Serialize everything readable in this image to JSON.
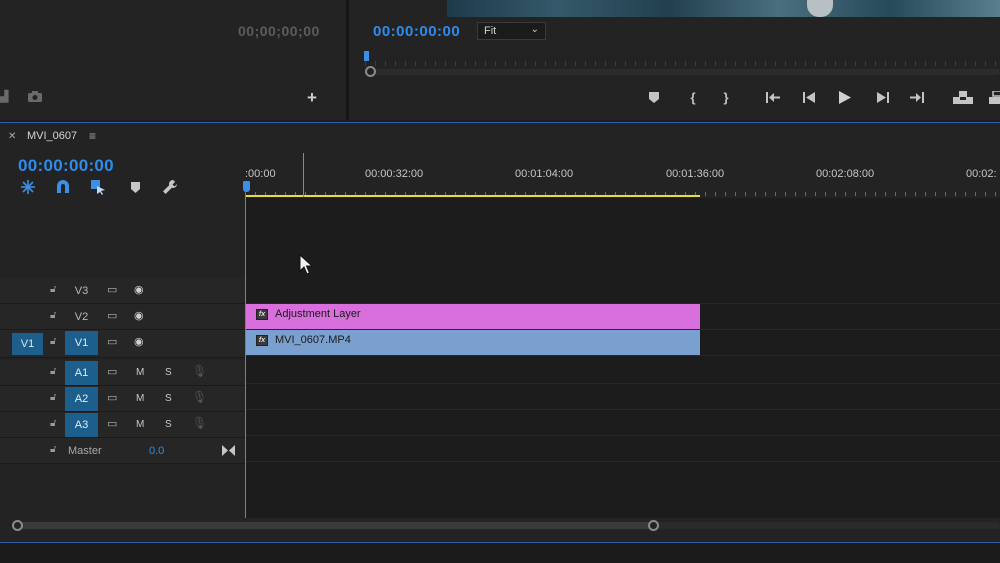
{
  "source_monitor": {
    "timecode": "00;00;00;00"
  },
  "program_monitor": {
    "timecode": "00:00:00:00",
    "zoom": "Fit",
    "transport_icons": [
      "add-marker-icon",
      "mark-in-icon",
      "mark-out-icon",
      "go-to-in-icon",
      "step-back-icon",
      "play-icon",
      "step-forward-icon",
      "go-to-out-icon",
      "lift-icon",
      "extract-icon"
    ]
  },
  "timeline": {
    "tab_name": "MVI_0607",
    "timecode": "00:00:00:00",
    "ruler_labels": [
      ":00:00",
      "00:00:32:00",
      "00:01:04:00",
      "00:01:36:00",
      "00:02:08:00",
      "00:02:"
    ],
    "tracks": {
      "v3": {
        "name": "V3"
      },
      "v2": {
        "name": "V2"
      },
      "v1": {
        "name": "V1",
        "source": "V1"
      },
      "a1": {
        "name": "A1",
        "m": "M",
        "s": "S"
      },
      "a2": {
        "name": "A2",
        "m": "M",
        "s": "S"
      },
      "a3": {
        "name": "A3",
        "m": "M",
        "s": "S"
      },
      "master": {
        "name": "Master",
        "value": "0.0"
      }
    },
    "clips": {
      "adjustment": {
        "label": "Adjustment Layer",
        "fx": "fx",
        "color": "#d86fdc"
      },
      "video": {
        "label": "MVI_0607.MP4",
        "fx": "fx",
        "color": "#7aa0cf"
      }
    },
    "colors": {
      "accent": "#2d8ceb",
      "work_area": "#e7de3b"
    }
  }
}
